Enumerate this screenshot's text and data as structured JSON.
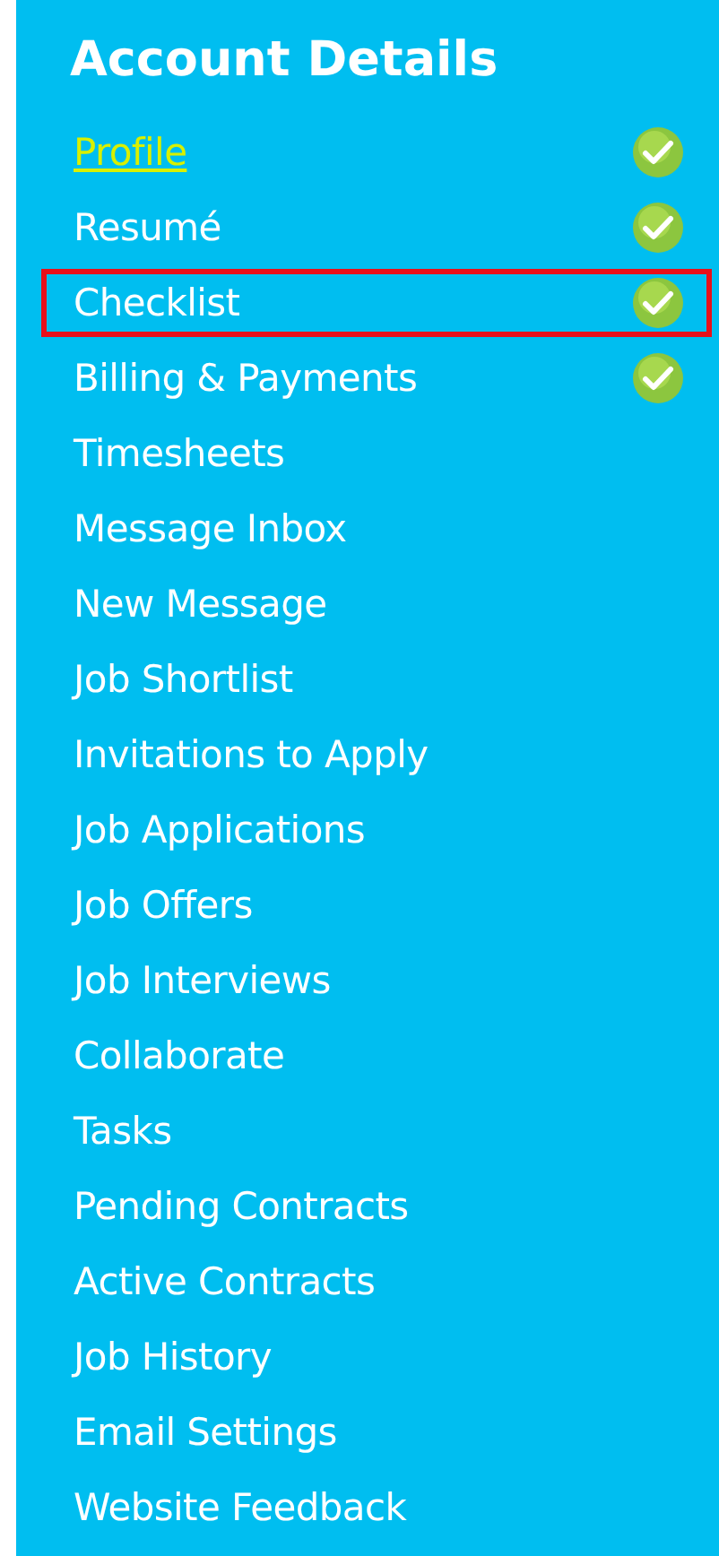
{
  "title": "Account Details",
  "items": [
    {
      "label": "Profile",
      "selected": true,
      "completed": true,
      "highlighted": false
    },
    {
      "label": "Resumé",
      "selected": false,
      "completed": true,
      "highlighted": false
    },
    {
      "label": "Checklist",
      "selected": false,
      "completed": true,
      "highlighted": true
    },
    {
      "label": "Billing & Payments",
      "selected": false,
      "completed": true,
      "highlighted": false
    },
    {
      "label": "Timesheets",
      "selected": false,
      "completed": false,
      "highlighted": false
    },
    {
      "label": "Message Inbox",
      "selected": false,
      "completed": false,
      "highlighted": false
    },
    {
      "label": "New Message",
      "selected": false,
      "completed": false,
      "highlighted": false
    },
    {
      "label": "Job Shortlist",
      "selected": false,
      "completed": false,
      "highlighted": false
    },
    {
      "label": "Invitations to Apply",
      "selected": false,
      "completed": false,
      "highlighted": false
    },
    {
      "label": "Job Applications",
      "selected": false,
      "completed": false,
      "highlighted": false
    },
    {
      "label": "Job Offers",
      "selected": false,
      "completed": false,
      "highlighted": false
    },
    {
      "label": "Job Interviews",
      "selected": false,
      "completed": false,
      "highlighted": false
    },
    {
      "label": "Collaborate",
      "selected": false,
      "completed": false,
      "highlighted": false
    },
    {
      "label": "Tasks",
      "selected": false,
      "completed": false,
      "highlighted": false
    },
    {
      "label": "Pending Contracts",
      "selected": false,
      "completed": false,
      "highlighted": false
    },
    {
      "label": "Active Contracts",
      "selected": false,
      "completed": false,
      "highlighted": false
    },
    {
      "label": "Job History",
      "selected": false,
      "completed": false,
      "highlighted": false
    },
    {
      "label": "Email Settings",
      "selected": false,
      "completed": false,
      "highlighted": false
    },
    {
      "label": "Website Feedback",
      "selected": false,
      "completed": false,
      "highlighted": false
    }
  ]
}
